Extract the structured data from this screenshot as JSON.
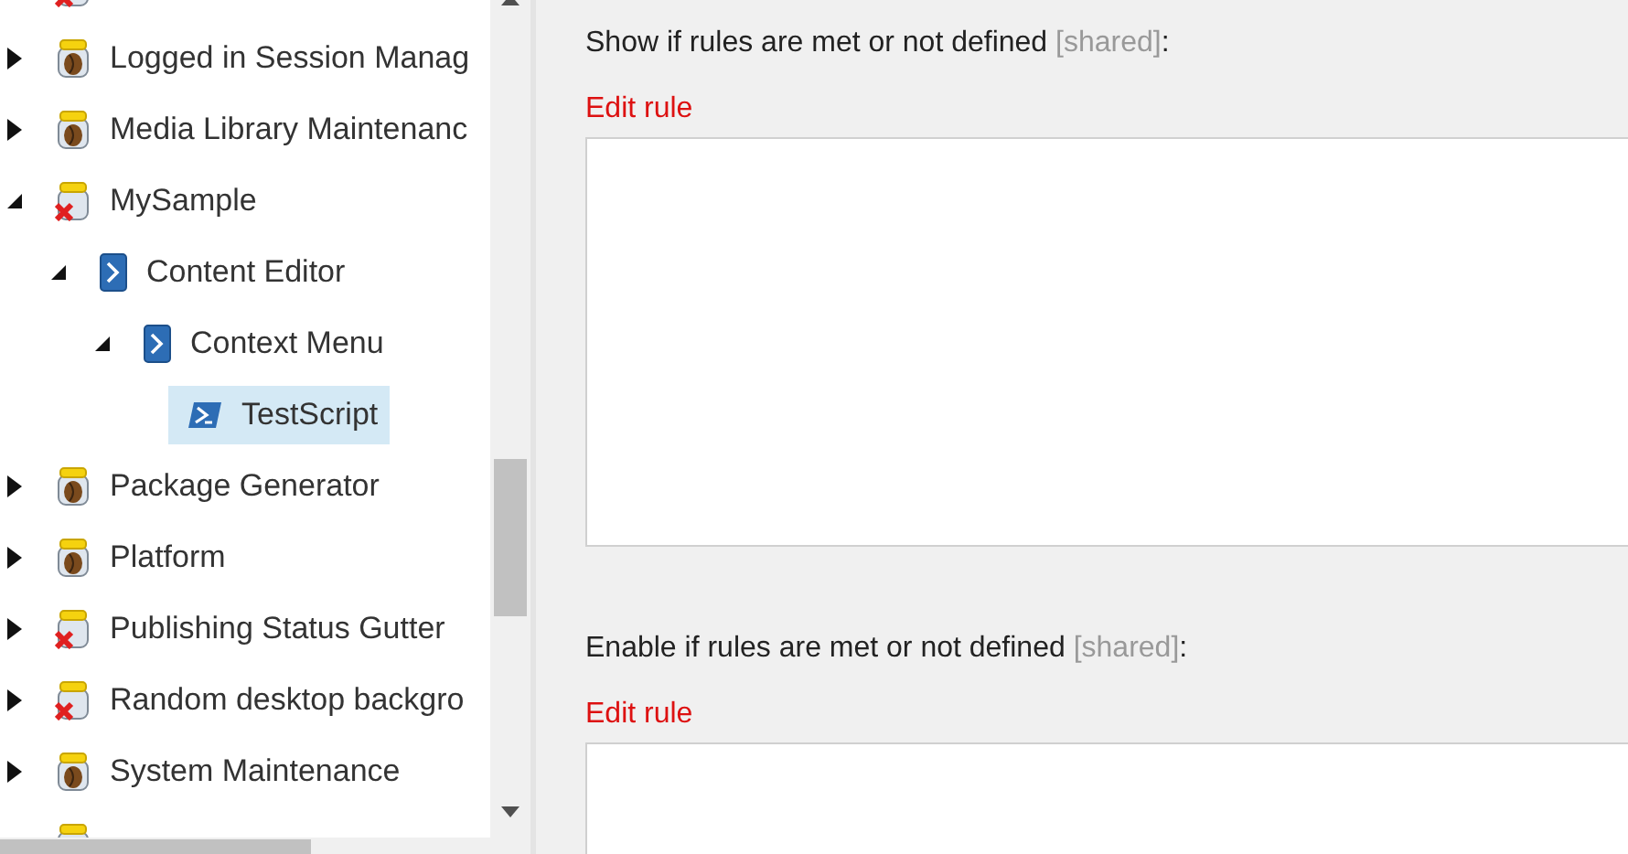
{
  "tree": [
    {
      "kind": "jar-x",
      "selected": false
    },
    {
      "label": "Logged in Session Manag",
      "kind": "jar",
      "expanded": false,
      "selected": false
    },
    {
      "label": "Media Library Maintenanc",
      "kind": "jar",
      "expanded": false,
      "selected": false
    },
    {
      "label": "MySample",
      "kind": "jar-x",
      "expanded": true,
      "selected": false,
      "children": [
        {
          "label": "Content Editor",
          "kind": "script-book",
          "expanded": true,
          "selected": false,
          "children": [
            {
              "label": "Context Menu",
              "kind": "script-book",
              "expanded": true,
              "selected": false,
              "children": [
                {
                  "label": "TestScript",
                  "kind": "script",
                  "selected": true
                }
              ]
            }
          ]
        }
      ]
    },
    {
      "label": "Package Generator",
      "kind": "jar",
      "expanded": false,
      "selected": false
    },
    {
      "label": "Platform",
      "kind": "jar",
      "expanded": false,
      "selected": false
    },
    {
      "label": "Publishing Status Gutter",
      "kind": "jar-x",
      "expanded": false,
      "selected": false
    },
    {
      "label": "Random desktop backgro",
      "kind": "jar-x",
      "expanded": false,
      "selected": false
    },
    {
      "label": "System Maintenance",
      "kind": "jar",
      "expanded": false,
      "selected": false
    },
    {
      "kind": "jar",
      "selected": false
    }
  ],
  "fields": [
    {
      "label": "Show if rules are met or not defined",
      "tag": "[shared]",
      "suffix": ":",
      "link": "Edit rule"
    },
    {
      "label": "Enable if rules are met or not defined",
      "tag": "[shared]",
      "suffix": ":",
      "link": "Edit rule"
    }
  ]
}
